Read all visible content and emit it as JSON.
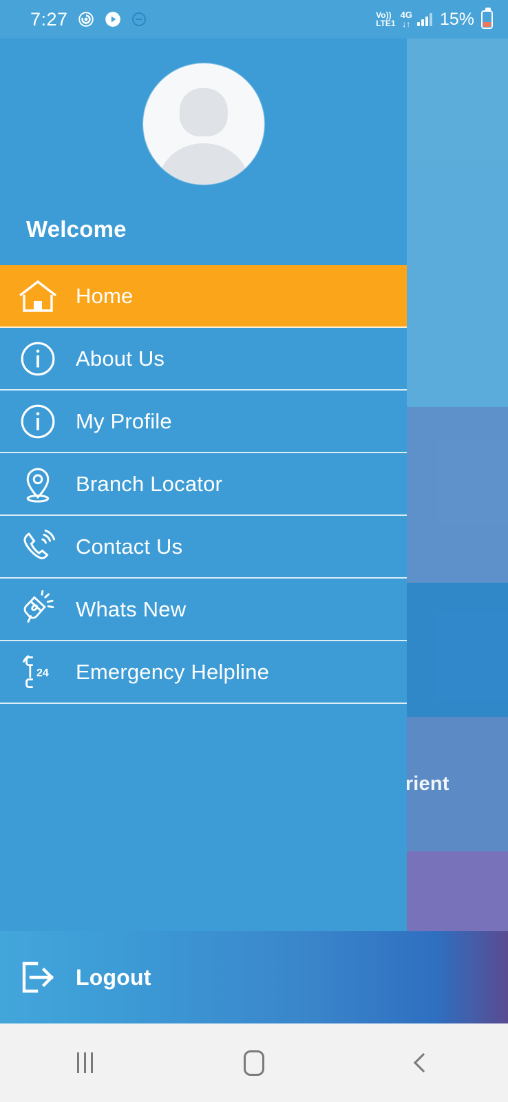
{
  "status_bar": {
    "time": "7:27",
    "icons": [
      "alarm-icon",
      "play-icon",
      "do-not-disturb-icon"
    ],
    "volte_line1": "Vo))",
    "volte_line2": "LTE1",
    "network_type": "4G",
    "data_arrows": "↓↑",
    "battery_percent": "15%"
  },
  "background": {
    "partial_title": "Orient"
  },
  "drawer": {
    "avatar_name": "default-user-avatar",
    "welcome_label": "Welcome",
    "items": [
      {
        "label": "Home",
        "icon": "home-icon",
        "active": true
      },
      {
        "label": "About Us",
        "icon": "info-icon",
        "active": false
      },
      {
        "label": "My Profile",
        "icon": "info-icon",
        "active": false
      },
      {
        "label": "Branch Locator",
        "icon": "location-pin-icon",
        "active": false
      },
      {
        "label": "Contact Us",
        "icon": "phone-ring-icon",
        "active": false
      },
      {
        "label": "Whats New",
        "icon": "megaphone-icon",
        "active": false
      },
      {
        "label": "Emergency Helpline",
        "icon": "phone-24-icon",
        "active": false
      }
    ],
    "logout_label": "Logout",
    "logout_icon": "logout-icon"
  },
  "nav_bar": {
    "recents_label": "recents-button",
    "home_label": "home-button",
    "back_label": "back-button"
  },
  "colors": {
    "drawer_blue": "#3d9cd6",
    "active_orange": "#faa51a",
    "text_white": "#ffffff",
    "battery_low": "#f0785a",
    "navbar_grey": "#f2f2f2"
  }
}
